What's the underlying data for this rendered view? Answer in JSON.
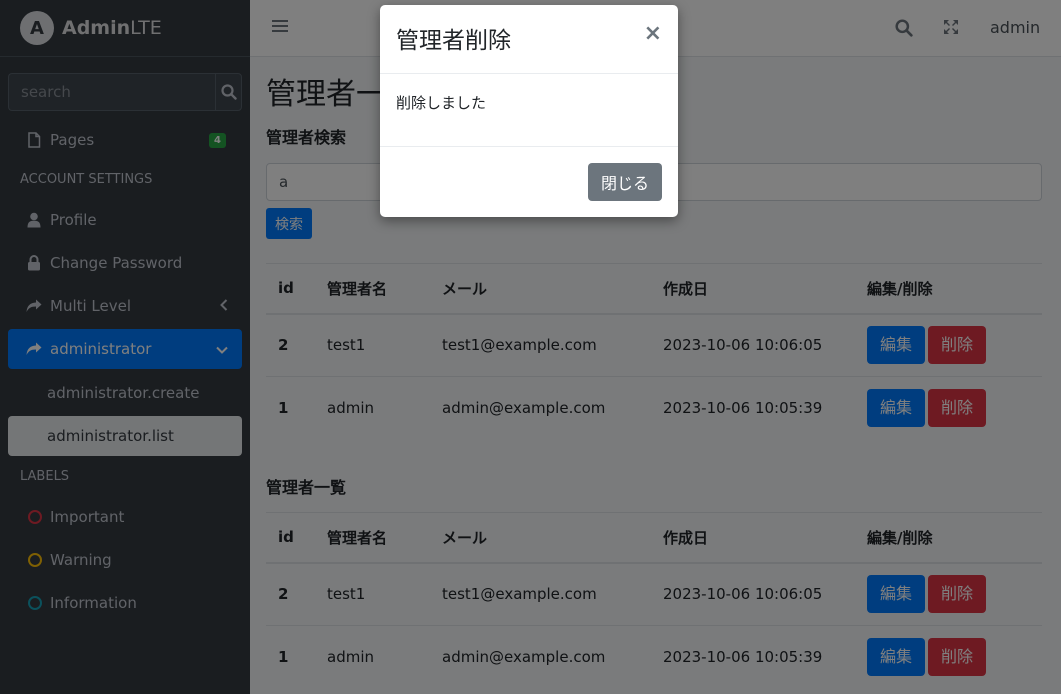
{
  "brand": {
    "logo_letter": "A",
    "name_bold": "Admin",
    "name_light": "LTE"
  },
  "sidebar": {
    "search_placeholder": "search",
    "pages": {
      "label": "Pages",
      "badge": "4"
    },
    "account_header": "ACCOUNT SETTINGS",
    "profile": "Profile",
    "change_password": "Change Password",
    "multi_level": "Multi Level",
    "administrator": "administrator",
    "admin_create": "administrator.create",
    "admin_list": "administrator.list",
    "labels_header": "LABELS",
    "labels": [
      {
        "label": "Important",
        "color": "#dc3545"
      },
      {
        "label": "Warning",
        "color": "#ffc107"
      },
      {
        "label": "Information",
        "color": "#17a2b8"
      }
    ]
  },
  "topbar": {
    "user": "admin"
  },
  "content": {
    "page_title": "管理者一覧",
    "search_title": "管理者検索",
    "search_value": "a",
    "search_button": "検索",
    "list_title": "管理者一覧",
    "table": {
      "headers": [
        "id",
        "管理者名",
        "メール",
        "作成日",
        "編集/削除"
      ],
      "rows": [
        {
          "id": "2",
          "name": "test1",
          "email": "test1@example.com",
          "created": "2023-10-06 10:06:05"
        },
        {
          "id": "1",
          "name": "admin",
          "email": "admin@example.com",
          "created": "2023-10-06 10:05:39"
        }
      ],
      "edit_label": "編集",
      "delete_label": "削除"
    }
  },
  "modal": {
    "title": "管理者削除",
    "close_symbol": "×",
    "message": "削除しました",
    "close_button": "閉じる"
  }
}
